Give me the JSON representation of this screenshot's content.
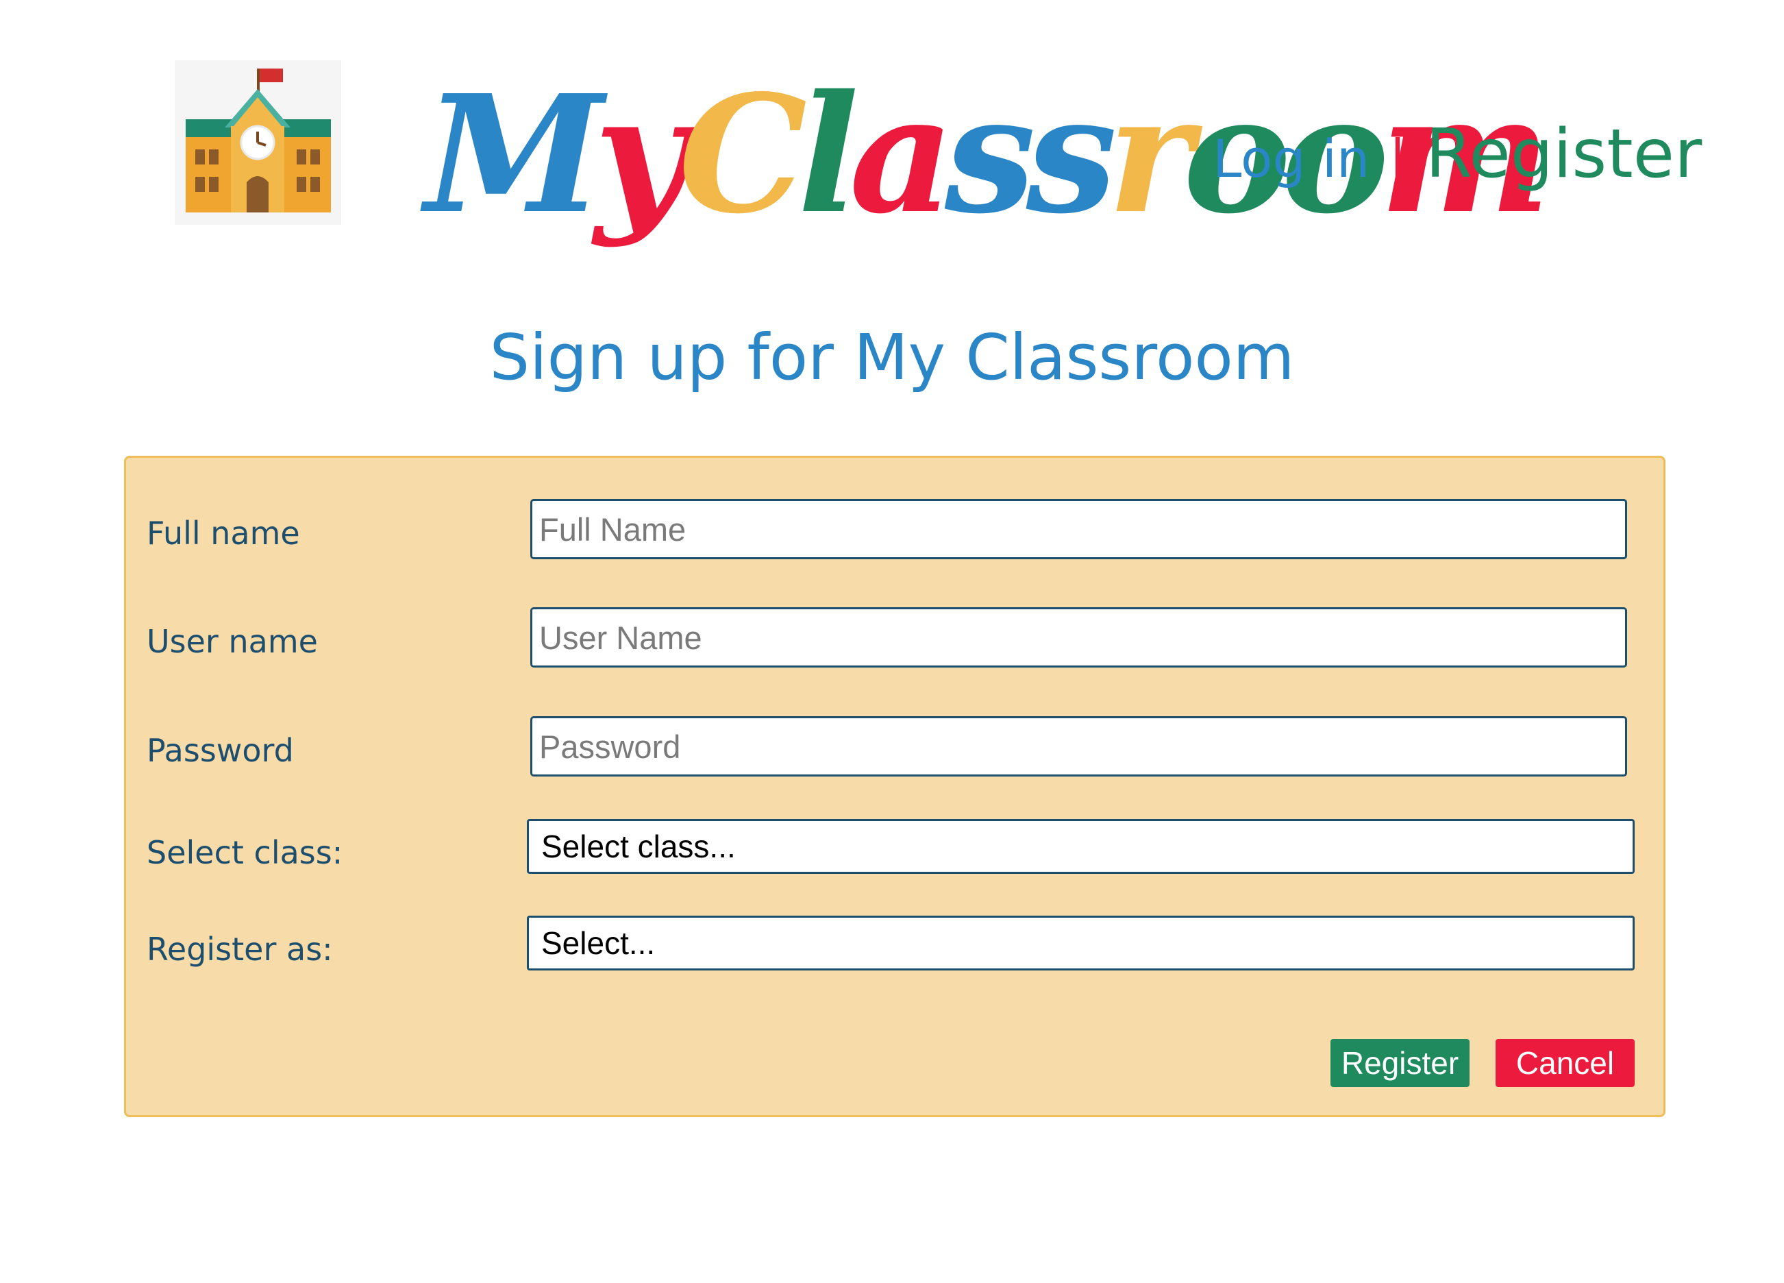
{
  "header": {
    "brand_letters": [
      {
        "char": "M",
        "color": "#2a86c6"
      },
      {
        "char": "y",
        "color": "#ec1a3c"
      },
      {
        "char": "C",
        "color": "#f2b94a"
      },
      {
        "char": "l",
        "color": "#1f8a5e"
      },
      {
        "char": "a",
        "color": "#ec1a3c"
      },
      {
        "char": "s",
        "color": "#2a86c6"
      },
      {
        "char": "s",
        "color": "#2a86c6"
      },
      {
        "char": "r",
        "color": "#f2b94a"
      },
      {
        "char": "o",
        "color": "#1f8a5e"
      },
      {
        "char": "o",
        "color": "#1f8a5e"
      },
      {
        "char": "m",
        "color": "#ec1a3c"
      }
    ],
    "logo_icon": "school-building-icon",
    "login_label": "Log in",
    "separator": "|",
    "register_label": "Register"
  },
  "page": {
    "title": "Sign up for My Classroom"
  },
  "form": {
    "full_name": {
      "label": "Full name",
      "placeholder": "Full Name",
      "value": ""
    },
    "user_name": {
      "label": "User name",
      "placeholder": "User Name",
      "value": ""
    },
    "password": {
      "label": "Password",
      "placeholder": "Password",
      "value": ""
    },
    "select_class": {
      "label": "Select class:",
      "selected": "Select class..."
    },
    "register_as": {
      "label": "Register as:",
      "selected": "Select..."
    },
    "register_button": "Register",
    "cancel_button": "Cancel"
  },
  "colors": {
    "blue": "#2a86c6",
    "red": "#ec1a3c",
    "yellow": "#f2b94a",
    "green": "#1f8a5e",
    "panel_bg": "#f7dba8",
    "panel_border": "#eebe5a",
    "label_text": "#1e4e6e"
  }
}
